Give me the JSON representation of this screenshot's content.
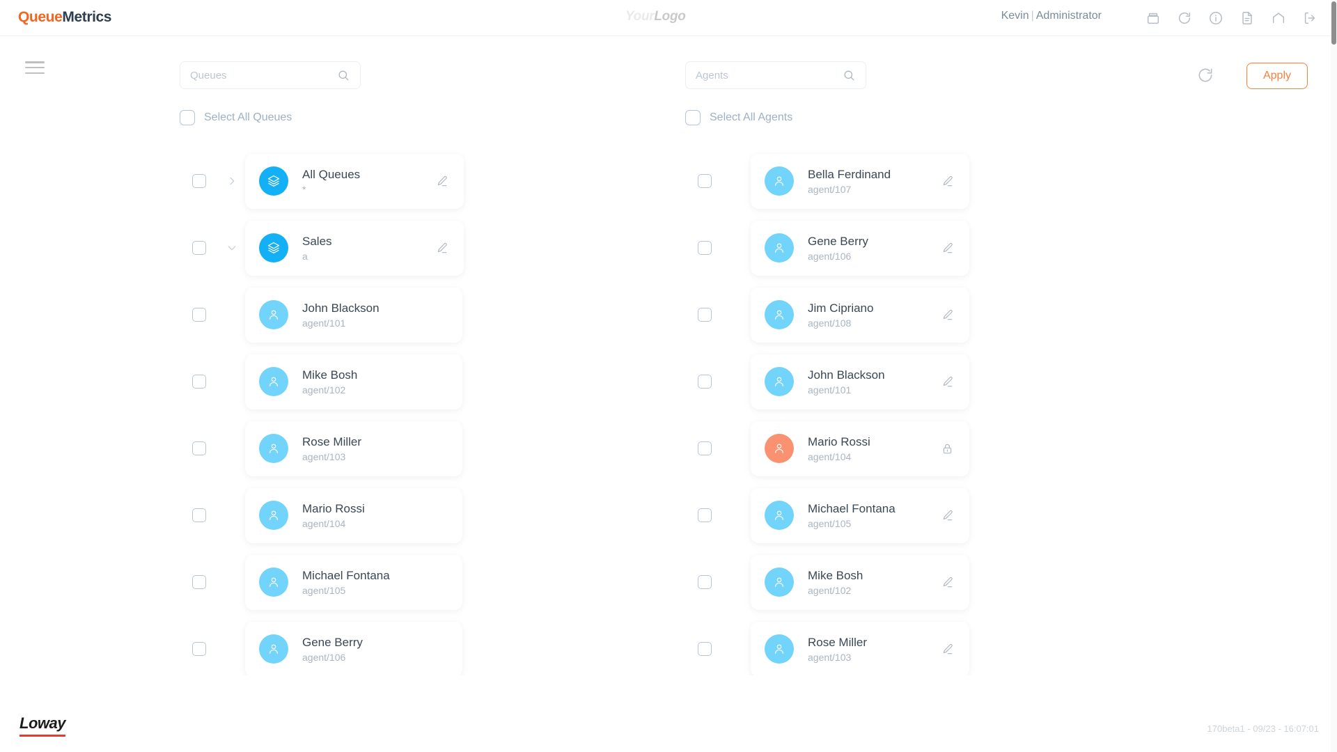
{
  "header": {
    "brand_prefix": "Queue",
    "brand_suffix": "Metrics",
    "logo_prefix": "Your",
    "logo_suffix": "Logo",
    "user": "Kevin",
    "separator": "|",
    "role": "Administrator",
    "icons": [
      {
        "name": "archive-icon",
        "label": "archive"
      },
      {
        "name": "refresh-icon",
        "label": "refresh"
      },
      {
        "name": "info-icon",
        "label": "info"
      },
      {
        "name": "document-icon",
        "label": "document"
      },
      {
        "name": "home-icon",
        "label": "home"
      },
      {
        "name": "logout-icon",
        "label": "logout"
      }
    ]
  },
  "toolbar": {
    "menu_label": "menu",
    "queues_search_placeholder": "Queues",
    "queues_search_value": "",
    "agents_search_placeholder": "Agents",
    "agents_search_value": "",
    "refresh_label": "refresh",
    "apply_label": "Apply"
  },
  "queues_panel": {
    "select_all_label": "Select All Queues",
    "select_all_checked": false,
    "items": [
      {
        "kind": "queue",
        "name": "All Queues",
        "key": "*",
        "expanded": false,
        "chevron": "right",
        "action": "edit",
        "checked": false,
        "avatar": "layers-icon",
        "avatar_color": "#13b0f5"
      },
      {
        "kind": "queue",
        "name": "Sales",
        "key": "a",
        "expanded": true,
        "chevron": "down",
        "action": "edit",
        "checked": false,
        "avatar": "layers-icon",
        "avatar_color": "#13b0f5"
      },
      {
        "kind": "agent",
        "name": "John Blackson",
        "key": "agent/101",
        "action": "none",
        "checked": false,
        "avatar": "person-icon",
        "avatar_color": "#72d4fb"
      },
      {
        "kind": "agent",
        "name": "Mike Bosh",
        "key": "agent/102",
        "action": "none",
        "checked": false,
        "avatar": "person-icon",
        "avatar_color": "#72d4fb"
      },
      {
        "kind": "agent",
        "name": "Rose Miller",
        "key": "agent/103",
        "action": "none",
        "checked": false,
        "avatar": "person-icon",
        "avatar_color": "#72d4fb"
      },
      {
        "kind": "agent",
        "name": "Mario Rossi",
        "key": "agent/104",
        "action": "none",
        "checked": false,
        "avatar": "person-icon",
        "avatar_color": "#72d4fb"
      },
      {
        "kind": "agent",
        "name": "Michael Fontana",
        "key": "agent/105",
        "action": "none",
        "checked": false,
        "avatar": "person-icon",
        "avatar_color": "#72d4fb"
      },
      {
        "kind": "agent",
        "name": "Gene Berry",
        "key": "agent/106",
        "action": "none",
        "checked": false,
        "avatar": "person-icon",
        "avatar_color": "#72d4fb"
      }
    ]
  },
  "agents_panel": {
    "select_all_label": "Select All Agents",
    "select_all_checked": false,
    "items": [
      {
        "kind": "agent",
        "name": "Bella Ferdinand",
        "key": "agent/107",
        "action": "edit",
        "checked": false,
        "avatar": "person-icon",
        "avatar_color": "#72d4fb"
      },
      {
        "kind": "agent",
        "name": "Gene Berry",
        "key": "agent/106",
        "action": "edit",
        "checked": false,
        "avatar": "person-icon",
        "avatar_color": "#72d4fb"
      },
      {
        "kind": "agent",
        "name": "Jim Cipriano",
        "key": "agent/108",
        "action": "edit",
        "checked": false,
        "avatar": "person-icon",
        "avatar_color": "#72d4fb"
      },
      {
        "kind": "agent",
        "name": "John Blackson",
        "key": "agent/101",
        "action": "edit",
        "checked": false,
        "avatar": "person-icon",
        "avatar_color": "#72d4fb"
      },
      {
        "kind": "agent",
        "name": "Mario Rossi",
        "key": "agent/104",
        "action": "lock",
        "checked": false,
        "avatar": "person-icon",
        "avatar_color": "#fa9271"
      },
      {
        "kind": "agent",
        "name": "Michael Fontana",
        "key": "agent/105",
        "action": "edit",
        "checked": false,
        "avatar": "person-icon",
        "avatar_color": "#72d4fb"
      },
      {
        "kind": "agent",
        "name": "Mike Bosh",
        "key": "agent/102",
        "action": "edit",
        "checked": false,
        "avatar": "person-icon",
        "avatar_color": "#72d4fb"
      },
      {
        "kind": "agent",
        "name": "Rose Miller",
        "key": "agent/103",
        "action": "edit",
        "checked": false,
        "avatar": "person-icon",
        "avatar_color": "#72d4fb"
      }
    ]
  },
  "footer": {
    "company": "Loway",
    "build": "170beta1 - 09/23 - 16:07:01"
  },
  "colors": {
    "accent_orange": "#f4823a",
    "brand_orange": "#f4651f",
    "queue_blue": "#13b0f5",
    "agent_blue": "#72d4fb",
    "agent_alt": "#fa9271"
  }
}
